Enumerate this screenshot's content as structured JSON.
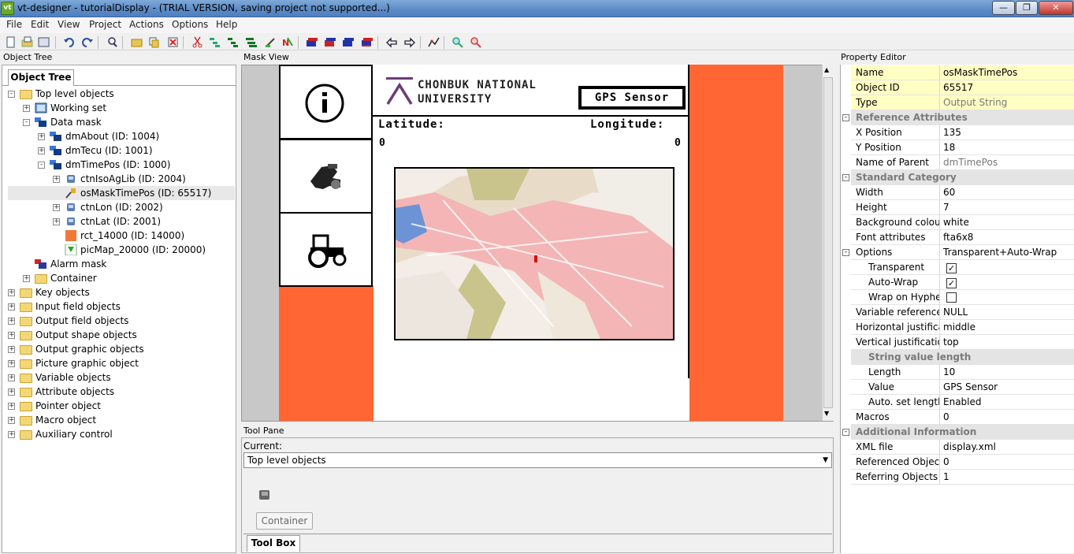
{
  "window": {
    "app_icon": "vt",
    "title": "vt-designer - tutorialDisplay  - (TRIAL VERSION, saving project not supported...)"
  },
  "menu": [
    "File",
    "Edit",
    "View",
    "Project",
    "Actions",
    "Options",
    "Help"
  ],
  "toolbar_icons": [
    "new-file-icon",
    "open-file-icon",
    "save-file-icon",
    "undo-icon",
    "redo-icon",
    "find-icon",
    "new-folder-icon",
    "copy-icon",
    "delete-icon",
    "cut-icon",
    "tree-expand-icon",
    "tree-collapse-icon",
    "tree-move-icon",
    "edit-pen-icon",
    "nu-icon",
    "bar-red-icon",
    "bar-blue-icon",
    "bar-mixed-icon",
    "bar-purple-icon",
    "arrow-left-icon",
    "arrow-right-icon",
    "run-icon",
    "zoom-in-icon",
    "zoom-out-icon"
  ],
  "object_tree": {
    "panel_title": "Object Tree",
    "tab_label": "Object Tree",
    "items": [
      {
        "label": "Top level objects",
        "depth": 0,
        "icon": "folder",
        "exp": "-"
      },
      {
        "label": "Working set",
        "depth": 1,
        "icon": "working-set",
        "exp": "+"
      },
      {
        "label": "Data mask",
        "depth": 1,
        "icon": "data-mask",
        "exp": "-"
      },
      {
        "label": "dmAbout (ID: 1004)",
        "depth": 2,
        "icon": "data-mask",
        "exp": "+"
      },
      {
        "label": "dmTecu (ID: 1001)",
        "depth": 2,
        "icon": "data-mask",
        "exp": "+"
      },
      {
        "label": "dmTimePos (ID: 1000)",
        "depth": 2,
        "icon": "data-mask",
        "exp": "-"
      },
      {
        "label": "ctnIsoAgLib (ID: 2004)",
        "depth": 3,
        "icon": "container",
        "exp": "+"
      },
      {
        "label": "osMaskTimePos (ID: 65517)",
        "depth": 3,
        "icon": "output-string",
        "exp": "",
        "selected": true
      },
      {
        "label": "ctnLon (ID: 2002)",
        "depth": 3,
        "icon": "container",
        "exp": "+"
      },
      {
        "label": "ctnLat (ID: 2001)",
        "depth": 3,
        "icon": "container",
        "exp": "+"
      },
      {
        "label": "rct_14000 (ID: 14000)",
        "depth": 3,
        "icon": "rect",
        "exp": ""
      },
      {
        "label": "picMap_20000 (ID: 20000)",
        "depth": 3,
        "icon": "picture",
        "exp": ""
      },
      {
        "label": "Alarm mask",
        "depth": 1,
        "icon": "alarm-mask",
        "exp": ""
      },
      {
        "label": "Container",
        "depth": 1,
        "icon": "folder",
        "exp": "+"
      },
      {
        "label": "Key objects",
        "depth": 0,
        "icon": "folder",
        "exp": "+"
      },
      {
        "label": "Input field objects",
        "depth": 0,
        "icon": "folder",
        "exp": "+"
      },
      {
        "label": "Output field objects",
        "depth": 0,
        "icon": "folder",
        "exp": "+"
      },
      {
        "label": "Output shape objects",
        "depth": 0,
        "icon": "folder",
        "exp": "+"
      },
      {
        "label": "Output graphic objects",
        "depth": 0,
        "icon": "folder",
        "exp": "+"
      },
      {
        "label": "Picture graphic object",
        "depth": 0,
        "icon": "folder",
        "exp": "+"
      },
      {
        "label": "Variable objects",
        "depth": 0,
        "icon": "folder",
        "exp": "+"
      },
      {
        "label": "Attribute objects",
        "depth": 0,
        "icon": "folder",
        "exp": "+"
      },
      {
        "label": "Pointer object",
        "depth": 0,
        "icon": "folder",
        "exp": "+"
      },
      {
        "label": "Macro object",
        "depth": 0,
        "icon": "folder",
        "exp": "+"
      },
      {
        "label": "Auxiliary control",
        "depth": 0,
        "icon": "folder",
        "exp": "+"
      }
    ]
  },
  "mask_view": {
    "panel_title": "Mask View",
    "university_line1": "CHONBUK NATIONAL",
    "university_line2": "UNIVERSITY",
    "gps_label": "GPS Sensor",
    "latitude_label": "Latitude:",
    "longitude_label": "Longitude:",
    "latitude_value": "0",
    "longitude_value": "0",
    "softkey_icons": [
      "info-icon",
      "sensor-icon",
      "tractor-icon"
    ],
    "colors": {
      "background_orange": "#ff6633"
    }
  },
  "tool_pane": {
    "panel_title": "Tool Pane",
    "current_label": "Current:",
    "current_value": "Top level objects",
    "container_button": "Container",
    "tab_label": "Tool Box"
  },
  "property_editor": {
    "panel_title": "Property Editor",
    "rows": [
      {
        "key": "Name",
        "value": "osMaskTimePos",
        "style": "yel"
      },
      {
        "key": "Object ID",
        "value": "65517",
        "style": "yel"
      },
      {
        "key": "Type",
        "value": "Output String",
        "style": "yel",
        "grey": true
      },
      {
        "key": "Reference Attributes",
        "value": "",
        "style": "cat",
        "exp": "-"
      },
      {
        "key": "X Position",
        "value": "135"
      },
      {
        "key": "Y Position",
        "value": "18"
      },
      {
        "key": "Name of Parent",
        "value": "dmTimePos",
        "grey": true
      },
      {
        "key": "Standard Category",
        "value": "",
        "style": "cat",
        "exp": "-"
      },
      {
        "key": "Width",
        "value": "60"
      },
      {
        "key": "Height",
        "value": "7"
      },
      {
        "key": "Background colour",
        "value": "white"
      },
      {
        "key": "Font attributes",
        "value": "fta6x8"
      },
      {
        "key": "Options",
        "value": "Transparent+Auto-Wrap",
        "exp": "-"
      },
      {
        "key": "Transparent",
        "value": "",
        "check": true,
        "indent": 1
      },
      {
        "key": "Auto-Wrap",
        "value": "",
        "check": true,
        "indent": 1
      },
      {
        "key": "Wrap on Hyphen",
        "value": "",
        "check": false,
        "indent": 1
      },
      {
        "key": "Variable reference",
        "value": "NULL"
      },
      {
        "key": "Horizontal justification",
        "value": "middle"
      },
      {
        "key": "Vertical justification",
        "value": "top"
      },
      {
        "key": "String value length",
        "value": "",
        "style": "cat",
        "exp": "-",
        "indent": 1
      },
      {
        "key": "Length",
        "value": "10",
        "indent": 1
      },
      {
        "key": "Value",
        "value": "GPS Sensor",
        "indent": 1
      },
      {
        "key": "Auto. set length",
        "value": "Enabled",
        "indent": 1
      },
      {
        "key": "Macros",
        "value": "0"
      },
      {
        "key": "Additional Information",
        "value": "",
        "style": "cat",
        "exp": "-"
      },
      {
        "key": "XML file",
        "value": "display.xml"
      },
      {
        "key": "Referenced Objects",
        "value": "0"
      },
      {
        "key": "Referring Objects",
        "value": "1"
      }
    ]
  }
}
